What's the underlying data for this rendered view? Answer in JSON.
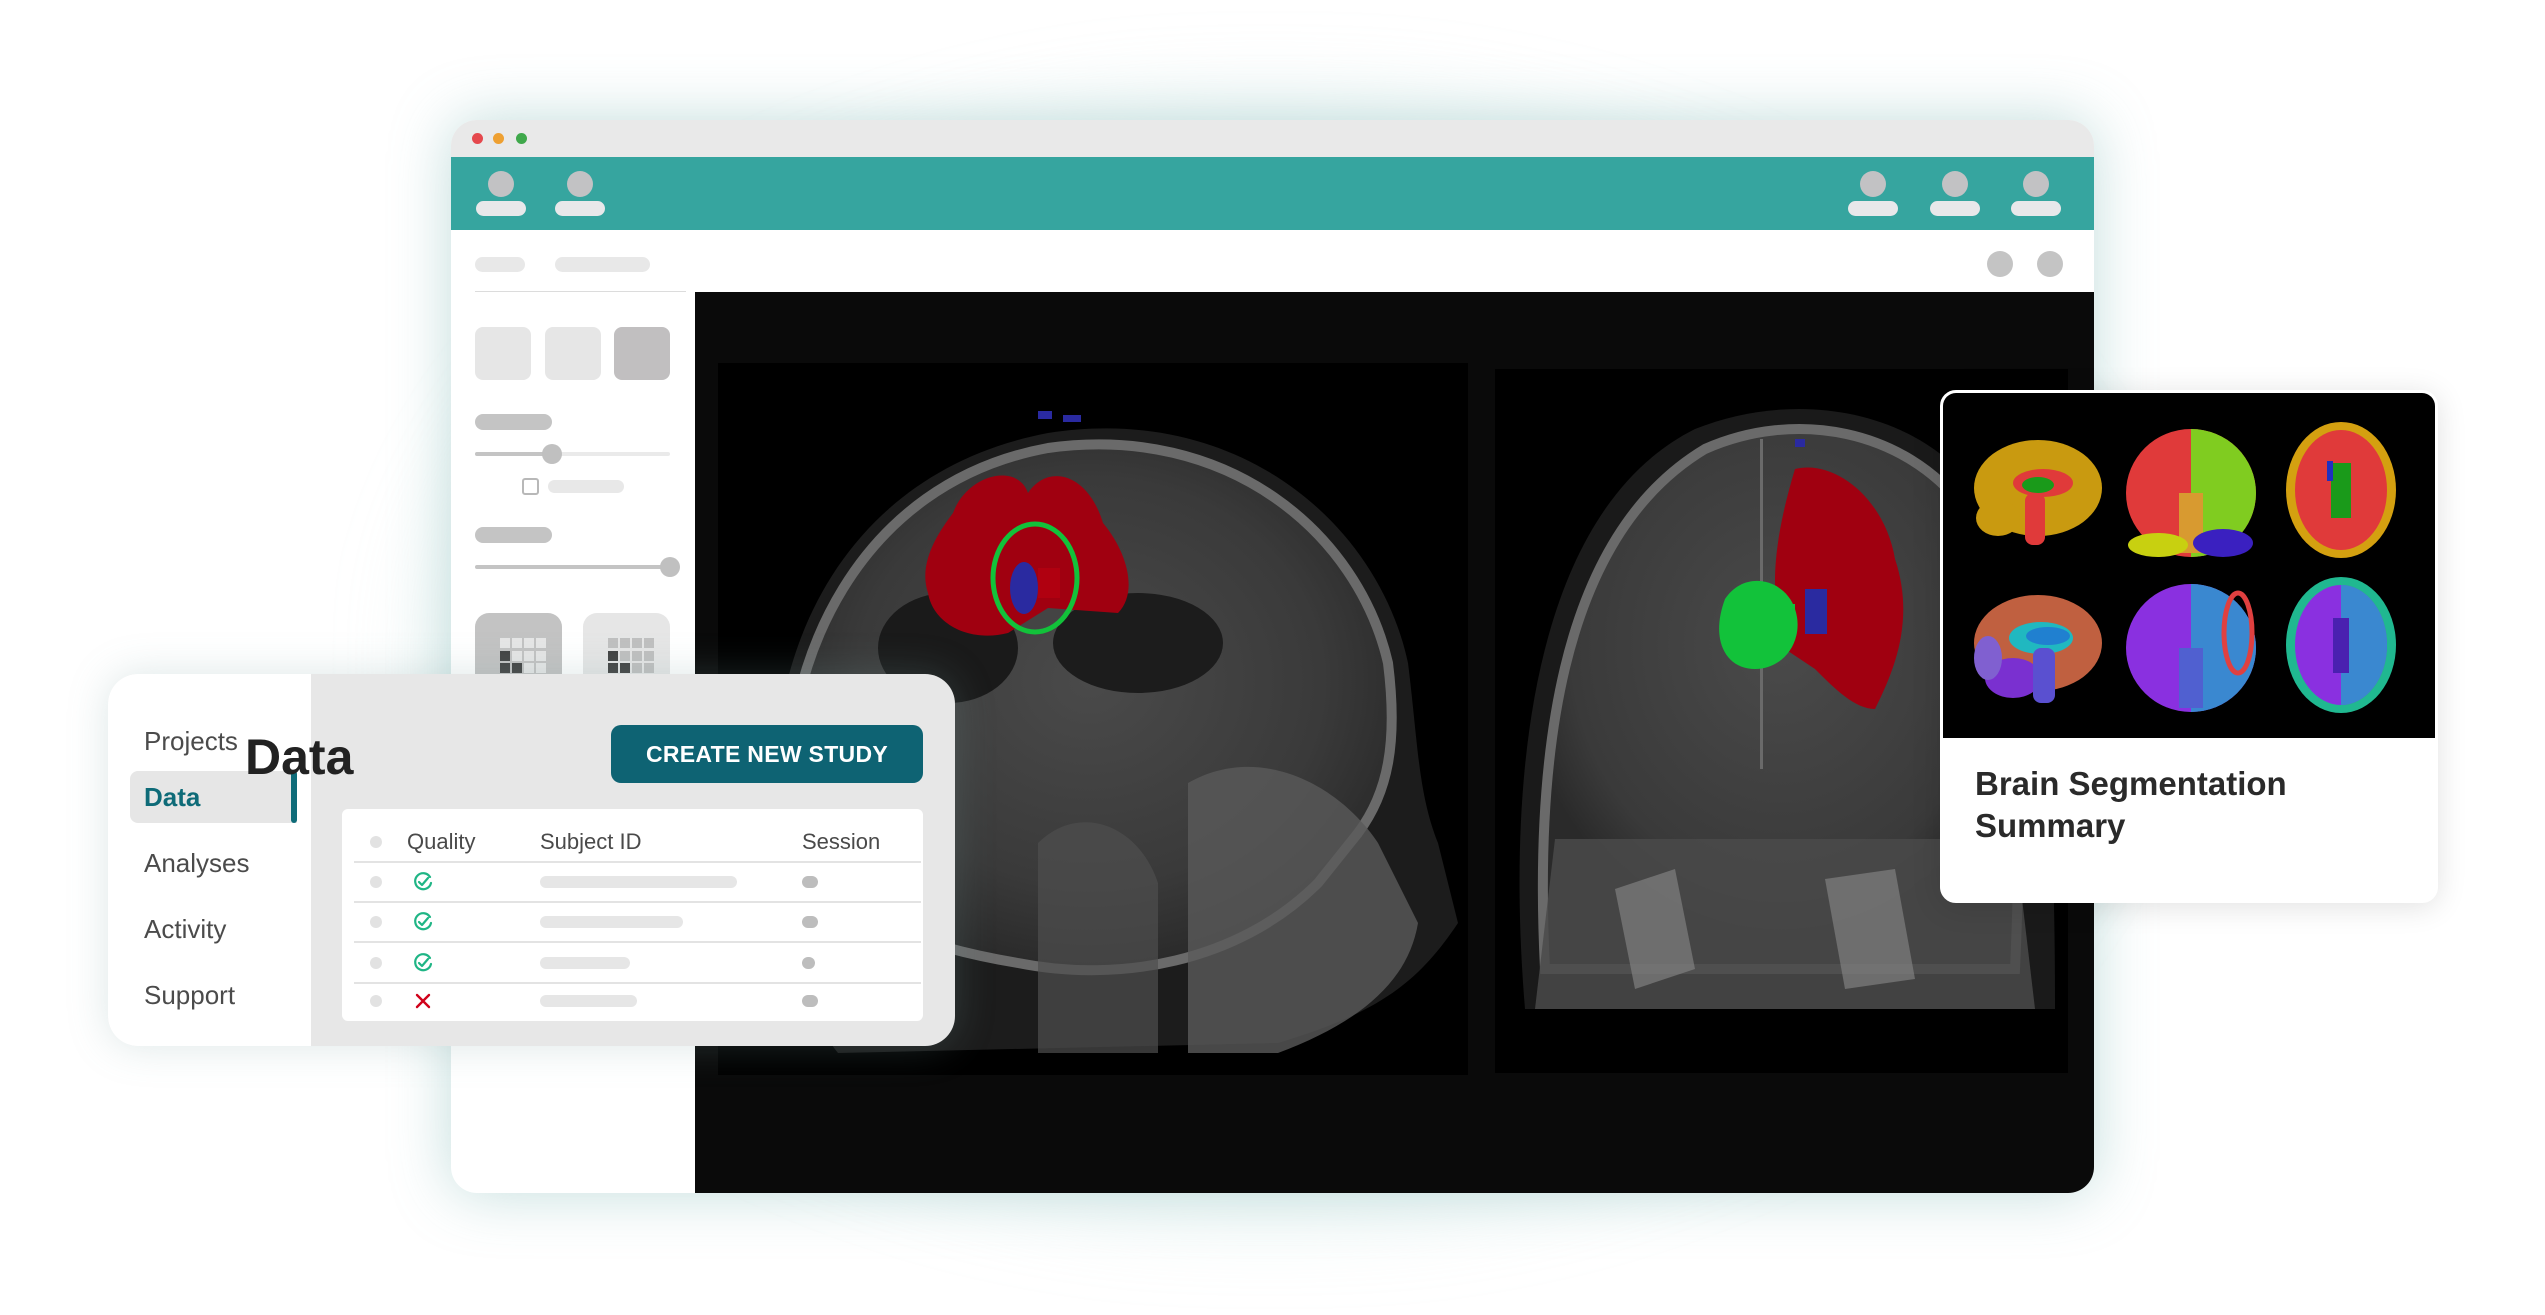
{
  "window": {
    "traffic_lights": [
      {
        "name": "close",
        "color": "#e5484d"
      },
      {
        "name": "minimize",
        "color": "#eea032"
      },
      {
        "name": "maximize",
        "color": "#3fa84b"
      }
    ],
    "header_color": "#36a59f"
  },
  "viewer": {
    "slices": [
      {
        "name": "sagittal",
        "label": "Sagittal slice with tumor segmentation"
      },
      {
        "name": "coronal",
        "label": "Coronal slice with tumor segmentation"
      }
    ],
    "segmentation_colors": {
      "edema": "#a00010",
      "enhancing": "#12c23a",
      "necrotic": "#2a2aa0"
    }
  },
  "data_panel": {
    "nav": [
      {
        "label": "Projects",
        "active": false
      },
      {
        "label": "Data",
        "active": true
      },
      {
        "label": "Analyses",
        "active": false
      },
      {
        "label": "Activity",
        "active": false
      },
      {
        "label": "Support",
        "active": false
      }
    ],
    "title": "Data",
    "create_button": "CREATE NEW STUDY",
    "table": {
      "columns": [
        "Quality",
        "Subject ID",
        "Session"
      ],
      "rows": [
        {
          "quality": "pass",
          "quality_icon": "check-circle-icon"
        },
        {
          "quality": "pass",
          "quality_icon": "check-circle-icon"
        },
        {
          "quality": "pass",
          "quality_icon": "check-circle-icon"
        },
        {
          "quality": "fail",
          "quality_icon": "x-icon"
        }
      ]
    },
    "accent": "#0e6b78",
    "pass_color": "#1fb585",
    "fail_color": "#d0021b"
  },
  "summary_card": {
    "title": "Brain Segmentation Summary"
  }
}
